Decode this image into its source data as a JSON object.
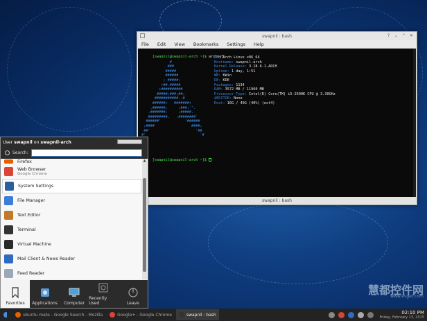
{
  "terminal": {
    "title": "swapnil : bash",
    "menu": [
      "File",
      "Edit",
      "View",
      "Bookmarks",
      "Settings",
      "Help"
    ],
    "prompt1": "[swapnil@swapnil-arch ~]$ ",
    "command": "archey3",
    "ascii": [
      "              +",
      "              #",
      "             ###",
      "            #####",
      "            ######",
      "           ; #####;",
      "          +##.#####",
      "         +##########",
      "        #####;###;##;",
      "       ###########..#",
      "      ######+   #######+",
      "     .######;     ;###;`\".",
      "    .#######;     ;#####.",
      "    #########.   .########`",
      "   ######'           '######",
      "  ;####                 ####;",
      "  ##'                     '##",
      " #'                         `#"
    ],
    "info": [
      {
        "k": "OS:",
        "v": " Arch Linux x86_64"
      },
      {
        "k": "Hostname:",
        "v": " swapnil-arch"
      },
      {
        "k": "Kernel Release:",
        "v": " 3.18.6-1-ARCH"
      },
      {
        "k": "Uptime:",
        "v": " 1 day, 1:51"
      },
      {
        "k": "WM:",
        "v": " KWin"
      },
      {
        "k": "DE:",
        "v": " KDE"
      },
      {
        "k": "Packages:",
        "v": " 1134"
      },
      {
        "k": "RAM:",
        "v": " 3572 MB / 11960 MB"
      },
      {
        "k": "Processor Type:",
        "v": " Intel(R) Core(TM) i5-2500K CPU @ 3.30GHz"
      },
      {
        "k": "$EDITOR:",
        "v": " None"
      },
      {
        "k": "Root:",
        "v": " 16G / 40G (40%) (ext4)"
      }
    ],
    "prompt2": "[swapnil@swapnil-arch ~]$ ",
    "status": "swapnil : bash"
  },
  "launcher": {
    "user_prefix": "User ",
    "user": "swapnil",
    "user_mid": " on ",
    "host": "swapnil-arch",
    "search_label": "Search:",
    "search_value": "",
    "items": [
      {
        "name": "Firefox",
        "sub": "",
        "icon_color": "#e66000"
      },
      {
        "name": "Web Browser",
        "sub": "Google Chrome",
        "icon_color": "#db4437"
      },
      {
        "name": "System Settings",
        "sub": "",
        "icon_color": "#2b5e9a"
      },
      {
        "name": "File Manager",
        "sub": "",
        "icon_color": "#3b7dd8"
      },
      {
        "name": "Text Editor",
        "sub": "",
        "icon_color": "#c07a2a"
      },
      {
        "name": "Terminal",
        "sub": "",
        "icon_color": "#333333"
      },
      {
        "name": "Virtual Machine",
        "sub": "",
        "icon_color": "#2a2a2a"
      },
      {
        "name": "Mail Client & News Reader",
        "sub": "",
        "icon_color": "#2f6cc0"
      },
      {
        "name": "Feed Reader",
        "sub": "",
        "icon_color": "#9aa8b8"
      }
    ],
    "tabs": [
      {
        "label": "Favorites",
        "active": true
      },
      {
        "label": "Applications",
        "active": false
      },
      {
        "label": "Computer",
        "active": false
      },
      {
        "label": "Recently Used",
        "active": false
      },
      {
        "label": "Leave",
        "active": false
      }
    ]
  },
  "taskbar": {
    "tasks": [
      {
        "label": "ubuntu mate - Google Search - Mozilla",
        "active": false
      },
      {
        "label": "Google+ - Google Chrome",
        "active": false
      },
      {
        "label": "swapnil : bash",
        "active": true
      }
    ],
    "time": "02:10 PM",
    "date": "Friday, February 13, 2015"
  },
  "watermark": {
    "main": "慧都控件网",
    "sub": "www.evget.com"
  }
}
